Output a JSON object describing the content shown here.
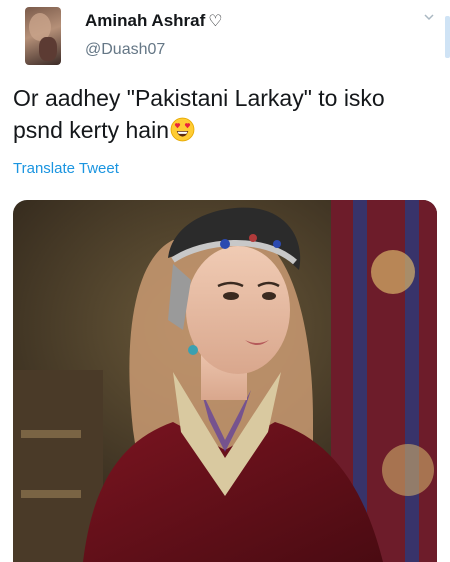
{
  "tweet": {
    "author_name": "Aminah Ashraf",
    "author_name_icon": "heart-outline-icon",
    "handle": "@Duash07",
    "text": "Or aadhey \"Pakistani Larkay\" to isko psnd kerty hain",
    "text_emoji": "heart-eyes-emoji-icon",
    "translate_label": "Translate Tweet",
    "menu_icon": "chevron-down-icon",
    "link_color": "#1b95e0",
    "secondary_color": "#657786"
  }
}
